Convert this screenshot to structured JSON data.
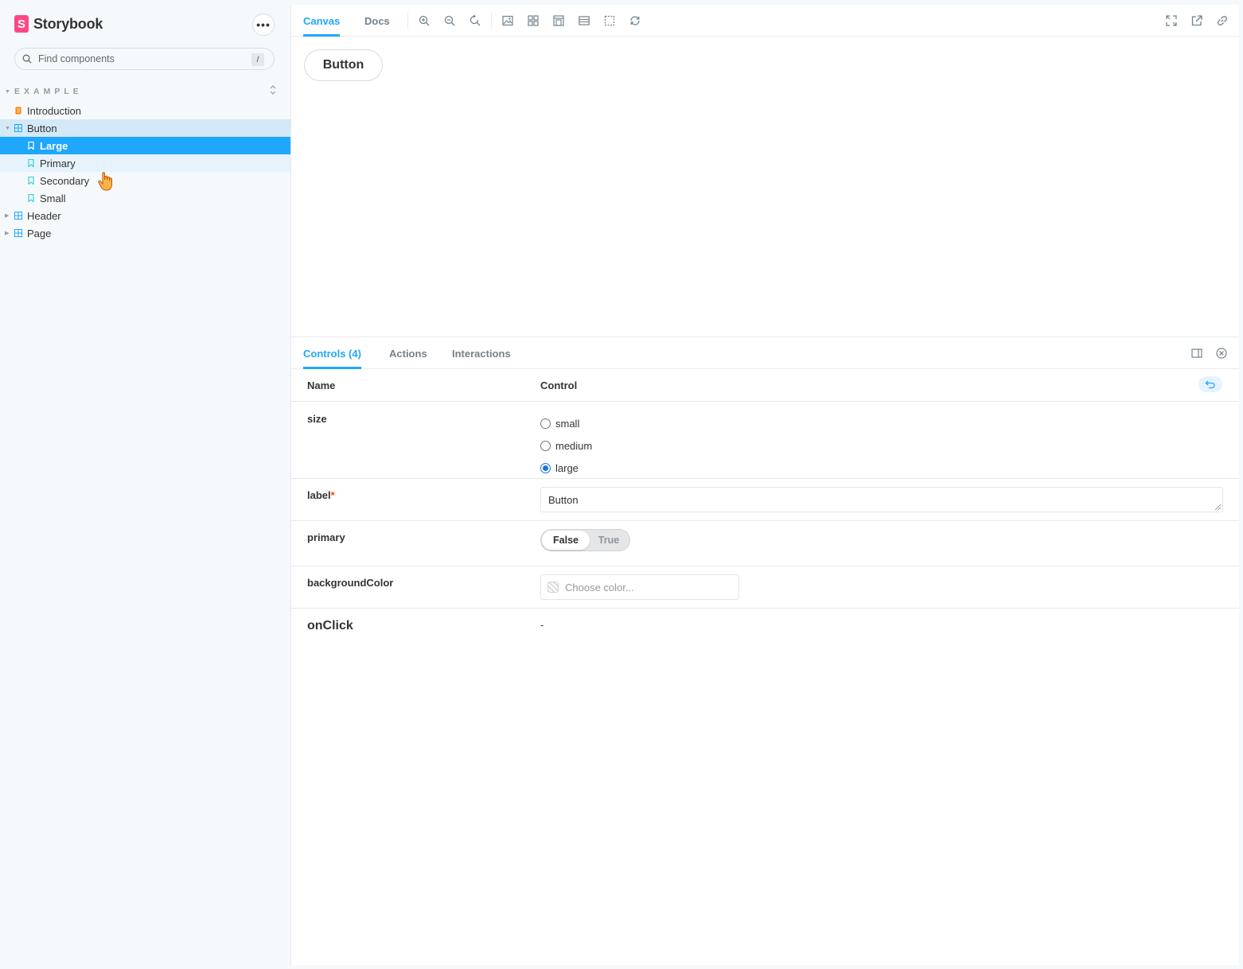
{
  "sidebar": {
    "brand": {
      "logo_letter": "S",
      "name": "Storybook"
    },
    "menu_button": "•••",
    "search": {
      "placeholder": "Find components",
      "shortcut": "/"
    },
    "section": {
      "title": "EXAMPLE",
      "toggle": "⌃⌄"
    },
    "items": [
      {
        "label": "Introduction",
        "kind": "doc",
        "depth": 0
      },
      {
        "label": "Button",
        "kind": "component",
        "depth": 0,
        "expanded": true
      },
      {
        "label": "Large",
        "kind": "story",
        "depth": 1,
        "selected": true
      },
      {
        "label": "Primary",
        "kind": "story",
        "depth": 1
      },
      {
        "label": "Secondary",
        "kind": "story",
        "depth": 1
      },
      {
        "label": "Small",
        "kind": "story",
        "depth": 1
      },
      {
        "label": "Header",
        "kind": "component",
        "depth": 0
      },
      {
        "label": "Page",
        "kind": "component",
        "depth": 0
      }
    ]
  },
  "toolbar": {
    "tabs": [
      {
        "label": "Canvas",
        "active": true
      },
      {
        "label": "Docs",
        "active": false
      }
    ],
    "tools": [
      "zoom-in-icon",
      "zoom-out-icon",
      "zoom-reset-icon",
      "background-icon",
      "grid-icon",
      "measure-icon",
      "viewport-icon",
      "outline-icon",
      "remount-icon"
    ],
    "right_tools": [
      "fullscreen-icon",
      "open-new-tab-icon",
      "copy-link-icon"
    ]
  },
  "canvas": {
    "preview_button_label": "Button"
  },
  "addons": {
    "tabs": [
      {
        "label": "Controls (4)",
        "active": true
      },
      {
        "label": "Actions",
        "active": false
      },
      {
        "label": "Interactions",
        "active": false
      }
    ],
    "table": {
      "headers": {
        "name": "Name",
        "control": "Control"
      },
      "rows": {
        "size": {
          "name": "size",
          "options": [
            "small",
            "medium",
            "large"
          ],
          "selected": "large"
        },
        "label": {
          "name": "label",
          "required_mark": "*",
          "value": "Button"
        },
        "primary": {
          "name": "primary",
          "false_label": "False",
          "true_label": "True",
          "value": false
        },
        "backgroundColor": {
          "name": "backgroundColor",
          "placeholder": "Choose color..."
        },
        "onClick": {
          "name": "onClick",
          "value": "-"
        }
      }
    }
  },
  "colors": {
    "accent": "#1ea7fd",
    "brand": "#ff4785",
    "doc_icon": "#ff8300",
    "required": "#ff4400"
  }
}
